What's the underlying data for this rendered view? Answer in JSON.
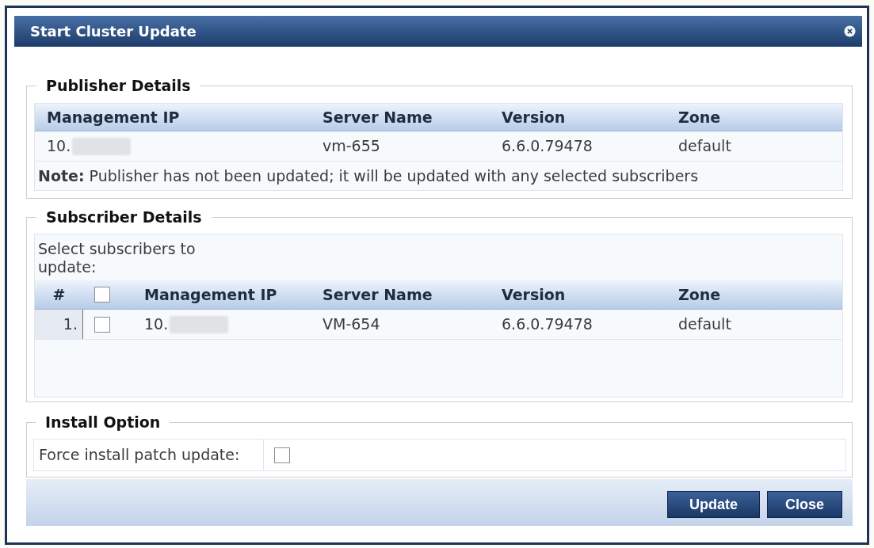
{
  "dialog": {
    "title": "Start Cluster Update"
  },
  "publisher": {
    "legend": "Publisher Details",
    "columns": [
      "Management IP",
      "Server Name",
      "Version",
      "Zone"
    ],
    "rows": [
      {
        "management_ip": "10.",
        "server_name": "vm-655",
        "version": "6.6.0.79478",
        "zone": "default"
      }
    ],
    "note": "**Note:** Publisher has not been updated; it will be updated with any selected subscribers"
  },
  "subscriber": {
    "legend": "Subscriber Details",
    "instruction": "Select subscribers to update:",
    "columns": [
      "#",
      "Management IP",
      "Server Name",
      "Version",
      "Zone"
    ],
    "select_all_checked": false,
    "rows": [
      {
        "number": "1.",
        "checked": false,
        "management_ip": "10.",
        "server_name": "VM-654",
        "version": "6.6.0.79478",
        "zone": "default"
      }
    ]
  },
  "install_option": {
    "legend": "Install Option",
    "fields": [
      {
        "label": "Force install patch update:",
        "checked": false
      }
    ]
  },
  "buttons": [
    {
      "label": "Update"
    },
    {
      "label": "Close"
    }
  ]
}
